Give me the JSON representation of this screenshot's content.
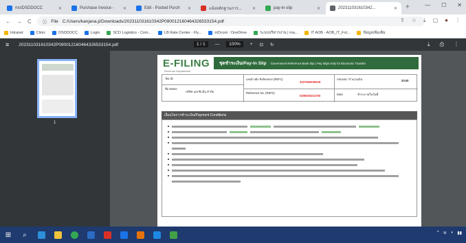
{
  "tabs": [
    {
      "label": "ms\\DSDDOCC",
      "color": "#1a73e8",
      "active": false
    },
    {
      "label": "Purchase Invoice -",
      "color": "#1a73e8",
      "active": false
    },
    {
      "label": "Edit - Posted Purch",
      "color": "#1a73e8",
      "active": false
    },
    {
      "label": "แจ้งหลักฐานการ...",
      "color": "#d93025",
      "active": false
    },
    {
      "label": "pay-in-slip",
      "color": "#34a853",
      "active": false
    },
    {
      "label": "202311031610342...",
      "color": "#5f6368",
      "active": true
    }
  ],
  "address": {
    "scheme": "File",
    "url": "C:/Users/kanjana.ji/Downloads/202311031610342P090012160464326533154.pdf"
  },
  "bookmarks": [
    {
      "label": "Intranet",
      "color": "#f4b400"
    },
    {
      "label": "Clinic",
      "color": "#1a73e8"
    },
    {
      "label": "DSDDOCC",
      "color": "#1a73e8"
    },
    {
      "label": "Login",
      "color": "#1a73e8"
    },
    {
      "label": "SCD Logistics - Com...",
      "color": "#34a853"
    },
    {
      "label": "LB Rate Center - Fly...",
      "color": "#1a73e8"
    },
    {
      "label": "mDcom : OneDrive",
      "color": "#1a73e8"
    },
    {
      "label": "ระบบบริหารงาน | ma...",
      "color": "#34a853"
    },
    {
      "label": "IT AOB - AOB_IT_Fol...",
      "color": "#f4b400"
    },
    {
      "label": "ข้อมูลเพิ่มเติม",
      "color": "#f4b400"
    }
  ],
  "pdf_toolbar": {
    "filename": "202311031610342P090012160464326533154.pdf",
    "page": "1",
    "total_pages": "1",
    "zoom": "100%",
    "page_number_label": "1"
  },
  "document": {
    "logo": "E-FILING",
    "logo_sub": "Revenue Department",
    "slip_title": "ชุดชำระเงิน/Pay-in Slip",
    "slip_subtitle": "Government Reference Bank Slip | Pay Slips Only for Electronic Transfer",
    "tax_id_label": "Tax ID",
    "name_label": "ชื่อ Name",
    "name_value": "บริษัท เอส.พี.เอ็น.จำกัด",
    "ref1_label": "เลขอ้างอิง Reference (REF1)",
    "ref1_value": "3107603030018",
    "ref2_label": "Reference No. (REF2)",
    "ref2_value": "03/09/20231700",
    "amount_label": "Amount / จำนวนเงิน",
    "amount_value": "20.00",
    "due_label": "Date",
    "due_value": "ชำระภายในวันที่",
    "conditions_title": "เงื่อนไขการชำระเงิน/Payment Conditions"
  }
}
